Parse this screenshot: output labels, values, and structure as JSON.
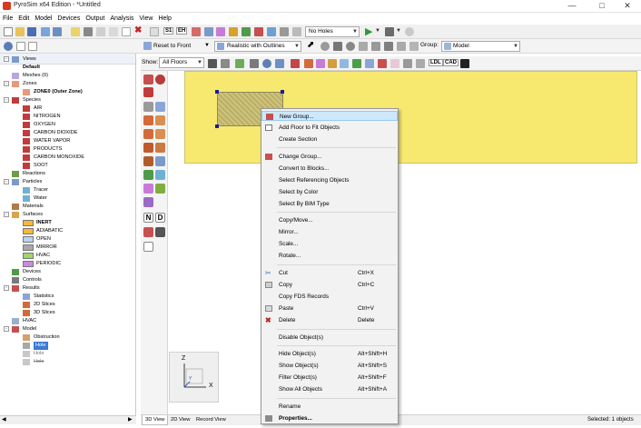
{
  "window": {
    "title": "PyroSim x64 Edition - *Untitled"
  },
  "menu": [
    "File",
    "Edit",
    "Model",
    "Devices",
    "Output",
    "Analysis",
    "View",
    "Help"
  ],
  "toolbar": {
    "s1": "S1",
    "e": "EH",
    "holes_combo": "No Holes",
    "reset_button": "Reset to Front",
    "render_combo": "Realistic with Outlines",
    "group_label": "Group:",
    "group_combo": "Model",
    "show_label": "Show:",
    "floors_combo": "All Floors",
    "ldl": "LDL",
    "cad": "CAD"
  },
  "tree": {
    "views": "Views",
    "default": "Default",
    "meshes": "Meshes (0)",
    "zones": "Zones",
    "zone0": "ZONE0 (Outer Zone)",
    "species": "Species",
    "species_items": [
      "AIR",
      "NITROGEN",
      "OXYGEN",
      "CARBON DIOXIDE",
      "WATER VAPOR",
      "PRODUCTS",
      "CARBON MONOXIDE",
      "SOOT"
    ],
    "reactions": "Reactions",
    "particles": "Particles",
    "tracer": "Tracer",
    "water": "Water",
    "materials": "Materials",
    "surfaces": "Surfaces",
    "surface_items": [
      {
        "label": "INERT",
        "color": "#f6b73a"
      },
      {
        "label": "ADIABATIC",
        "color": "#f6b73a"
      },
      {
        "label": "OPEN",
        "color": "#b9d3f0"
      },
      {
        "label": "MIRROR",
        "color": "#a8a8a8"
      },
      {
        "label": "HVAC",
        "color": "#9fd46a"
      },
      {
        "label": "PERIODIC",
        "color": "#c98be0"
      }
    ],
    "devices": "Devices",
    "controls": "Controls",
    "results": "Results",
    "statistics": "Statistics",
    "slices2d": "2D Slices",
    "slices3d": "3D Slices",
    "hvac": "HVAC",
    "model": "Model",
    "obstruction": "Obstruction",
    "hole_selected": "Hole",
    "hole2": "Hole",
    "hole3": "Hole"
  },
  "axes": {
    "z": "Z",
    "x": "X",
    "y": "Y"
  },
  "status": {
    "tab_3d": "3D View",
    "tab_2d": "2D View",
    "tab_record": "Record View",
    "selected": "Selected: 1 objects"
  },
  "context_menu": {
    "new_group": "New Group...",
    "add_floor": "Add Floor to Fit Objects",
    "create_section": "Create Section",
    "change_group": "Change Group...",
    "convert_blocks": "Convert to Blocks...",
    "select_referencing": "Select Referencing Objects",
    "select_color": "Select by Color",
    "select_bim": "Select By BIM Type",
    "copy_move": "Copy/Move...",
    "mirror": "Mirror...",
    "scale": "Scale...",
    "rotate": "Rotate...",
    "cut": "Cut",
    "cut_sc": "Ctrl+X",
    "copy": "Copy",
    "copy_sc": "Ctrl+C",
    "copy_fds": "Copy FDS Records",
    "paste": "Paste",
    "paste_sc": "Ctrl+V",
    "delete": "Delete",
    "delete_sc": "Delete",
    "disable": "Disable Object(s)",
    "hide": "Hide Object(s)",
    "hide_sc": "Alt+Shift+H",
    "show": "Show Object(s)",
    "show_sc": "Alt+Shift+S",
    "filter": "Filter Object(s)",
    "filter_sc": "Alt+Shift+F",
    "show_all": "Show All Objects",
    "show_all_sc": "Alt+Shift+A",
    "rename": "Rename",
    "properties": "Properties..."
  },
  "colors": {
    "floor": "#f7e870",
    "selection": "#cce8ff",
    "accent": "#d43c1f"
  }
}
